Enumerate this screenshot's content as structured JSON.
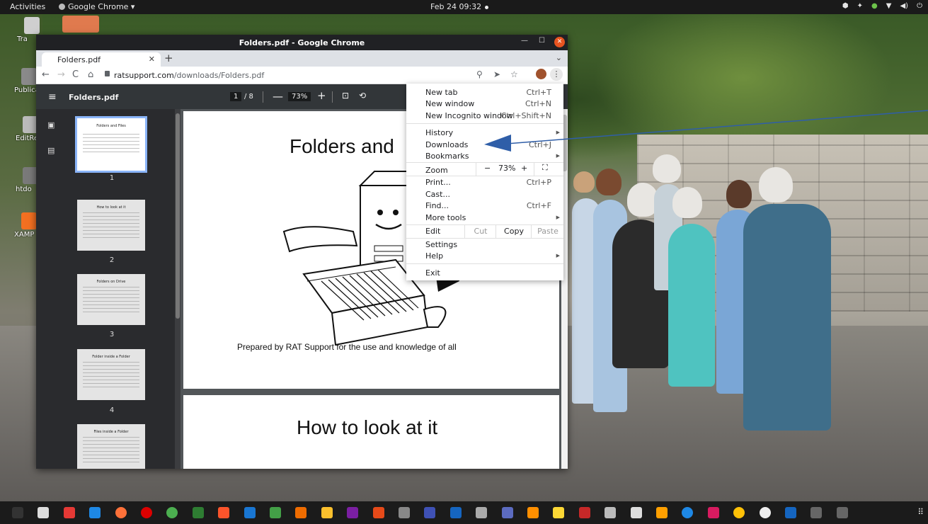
{
  "topbar": {
    "activities": "Activities",
    "app_menu": "Google Chrome ▾",
    "clock": "Feb 24  09:32"
  },
  "desktop_icons": [
    {
      "label": "Tra",
      "color": "#cfcfcf"
    },
    {
      "label": "Publica",
      "color": "#8a8a8a"
    },
    {
      "label": "EditRe",
      "color": "#bbbbbb"
    },
    {
      "label": "htdo",
      "color": "#7a7a7a"
    },
    {
      "label": "XAMP",
      "color": "#f37021"
    }
  ],
  "window": {
    "title": "Folders.pdf - Google Chrome",
    "tab_label": "Folders.pdf",
    "url_host": "ratsupport.com",
    "url_path": "/downloads/Folders.pdf"
  },
  "pdf": {
    "filename": "Folders.pdf",
    "page_current": "1",
    "page_total": "/ 8",
    "zoom": "73%",
    "thumbnails": [
      {
        "num": "1",
        "title": "Folders and Files"
      },
      {
        "num": "2",
        "title": "How to look at it"
      },
      {
        "num": "3",
        "title": "Folders on Drive"
      },
      {
        "num": "4",
        "title": "Folder inside a Folder"
      },
      {
        "num": "",
        "title": "Files inside a Folder"
      }
    ],
    "page1_heading": "Folders and",
    "page1_caption": "Prepared by RAT Support for the use and knowledge of all",
    "page2_heading": "How to look at it"
  },
  "menu": {
    "new_tab": "New tab",
    "new_tab_sc": "Ctrl+T",
    "new_window": "New window",
    "new_window_sc": "Ctrl+N",
    "new_incognito": "New Incognito window",
    "new_incognito_sc": "Ctrl+Shift+N",
    "history": "History",
    "downloads": "Downloads",
    "downloads_sc": "Ctrl+J",
    "bookmarks": "Bookmarks",
    "zoom": "Zoom",
    "zoom_minus": "−",
    "zoom_value": "73%",
    "zoom_plus": "+",
    "print": "Print...",
    "print_sc": "Ctrl+P",
    "cast": "Cast...",
    "find": "Find...",
    "find_sc": "Ctrl+F",
    "more_tools": "More tools",
    "edit": "Edit",
    "cut": "Cut",
    "copy": "Copy",
    "paste": "Paste",
    "settings": "Settings",
    "help": "Help",
    "exit": "Exit"
  },
  "colors": {
    "annotation_arrow": "#2f5ea8",
    "chrome_close": "#e95420"
  },
  "dock": [
    {
      "name": "terminal-icon",
      "color": "#333"
    },
    {
      "name": "files-icon",
      "color": "#ddd"
    },
    {
      "name": "app-red-icon",
      "color": "#e53935"
    },
    {
      "name": "app-blue-icon",
      "color": "#1e88e5"
    },
    {
      "name": "firefox-icon",
      "color": "#ff7139"
    },
    {
      "name": "opera-icon",
      "color": "#d00"
    },
    {
      "name": "chrome-icon",
      "color": "#4caf50"
    },
    {
      "name": "edge-dev-icon",
      "color": "#2e7d32"
    },
    {
      "name": "brave-icon",
      "color": "#fb542b"
    },
    {
      "name": "doc-blue-icon",
      "color": "#1976d2"
    },
    {
      "name": "calc-icon",
      "color": "#43a047"
    },
    {
      "name": "impress-icon",
      "color": "#ef6c00"
    },
    {
      "name": "draw-icon",
      "color": "#fbc02d"
    },
    {
      "name": "base-icon",
      "color": "#7b1fa2"
    },
    {
      "name": "software-icon",
      "color": "#e64a19"
    },
    {
      "name": "skype-like-icon",
      "color": "#888"
    },
    {
      "name": "app-blue2-icon",
      "color": "#3f51b5"
    },
    {
      "name": "screen-icon",
      "color": "#1565c0"
    },
    {
      "name": "tool-icon",
      "color": "#aaa"
    },
    {
      "name": "obs-icon",
      "color": "#5c6bc0"
    },
    {
      "name": "vlc-icon",
      "color": "#ff8f00"
    },
    {
      "name": "record-icon",
      "color": "#fdd835"
    },
    {
      "name": "filezilla-icon",
      "color": "#c62828"
    },
    {
      "name": "disc-icon",
      "color": "#bbb"
    },
    {
      "name": "anydesk-icon",
      "color": "#ddd"
    },
    {
      "name": "notes-icon",
      "color": "#ffa000"
    },
    {
      "name": "contacts-icon",
      "color": "#1e88e5"
    },
    {
      "name": "mascot-icon",
      "color": "#d81b60"
    },
    {
      "name": "b-icon",
      "color": "#ffc107"
    },
    {
      "name": "dvd-icon",
      "color": "#eee"
    },
    {
      "name": "network-icon",
      "color": "#1565c0"
    },
    {
      "name": "usb-icon",
      "color": "#666"
    },
    {
      "name": "usb2-icon",
      "color": "#666"
    }
  ]
}
